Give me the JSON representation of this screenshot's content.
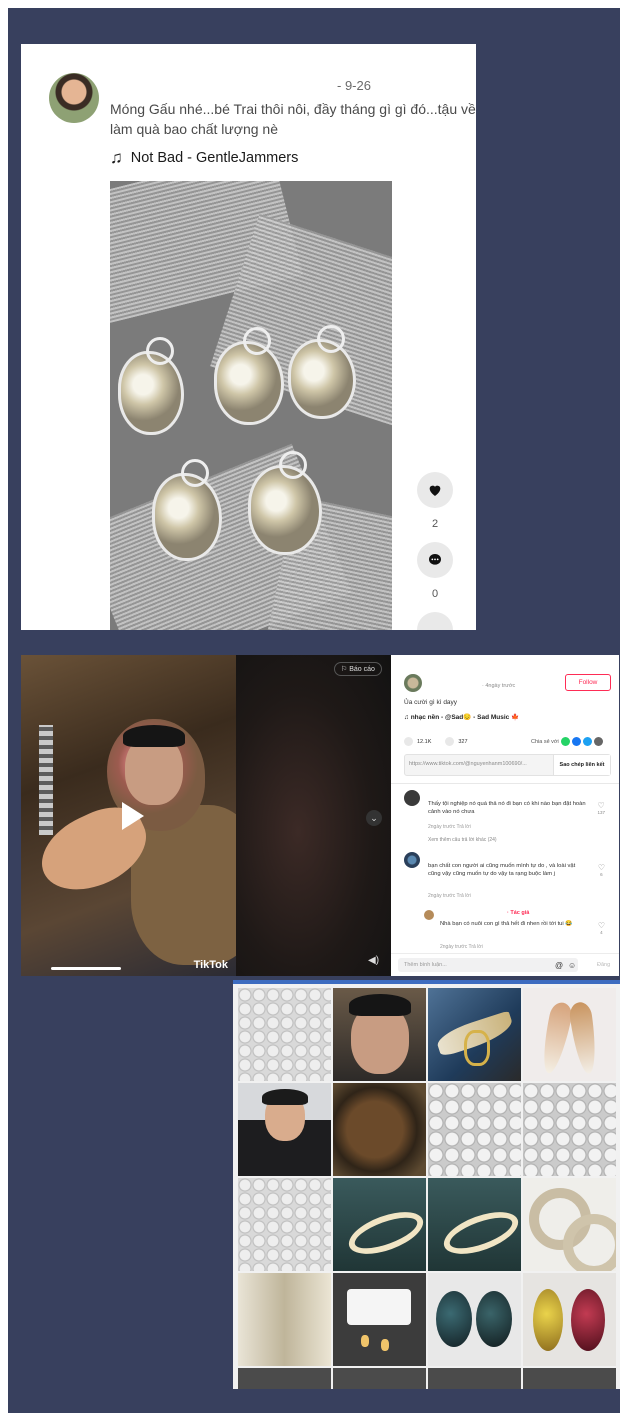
{
  "post": {
    "date": "- 9-26",
    "caption": "Móng Gấu nhé...bé Trai thôi nôi, đầy tháng gì gì đó...tậu về làm quà bao chất lượng nè",
    "music": "Not Bad - GentleJammers",
    "likes": "2",
    "comments": "0"
  },
  "player": {
    "report": "Báo cáo",
    "watermark": "TikTok",
    "panel": {
      "time": "· 4ngày trước",
      "follow": "Follow",
      "description": "Ủa cười gì kì dayy",
      "music": "nhạc nền - @Sad😔 - Sad Music 🍁",
      "like_count": "12.1K",
      "comment_count": "327",
      "share_label": "Chia sẻ với",
      "url": "https://www.tiktok.com/@nguyenhanm100690/...",
      "copy_link": "Sao chép liên kết",
      "comments": [
        {
          "text": "Thấy tội nghiệp nó quá thả nó đi bạn có khi nào bạn đặt hoàn cảnh vào nó chưa",
          "meta": "2ngày trước    Trả lời",
          "likes": "137",
          "more": "Xem thêm câu trả lời khác (24)"
        },
        {
          "text": "bạn chất con người ai cũng muốn mình tự do , và loài vật cũng vậy cũng muốn tự do vậy ta rạng buộc làm j",
          "meta": "2ngày trước    Trả lời",
          "likes": "6"
        }
      ],
      "reply": {
        "author": "· Tác giả",
        "text": "Nhà bạn có nuôi con gì thả hết đi nhen rồi tới tui 😂",
        "meta": "2ngày trước    Trả lời",
        "likes": "4"
      },
      "input_placeholder": "Thêm bình luận...",
      "post_button": "Đăng"
    }
  }
}
